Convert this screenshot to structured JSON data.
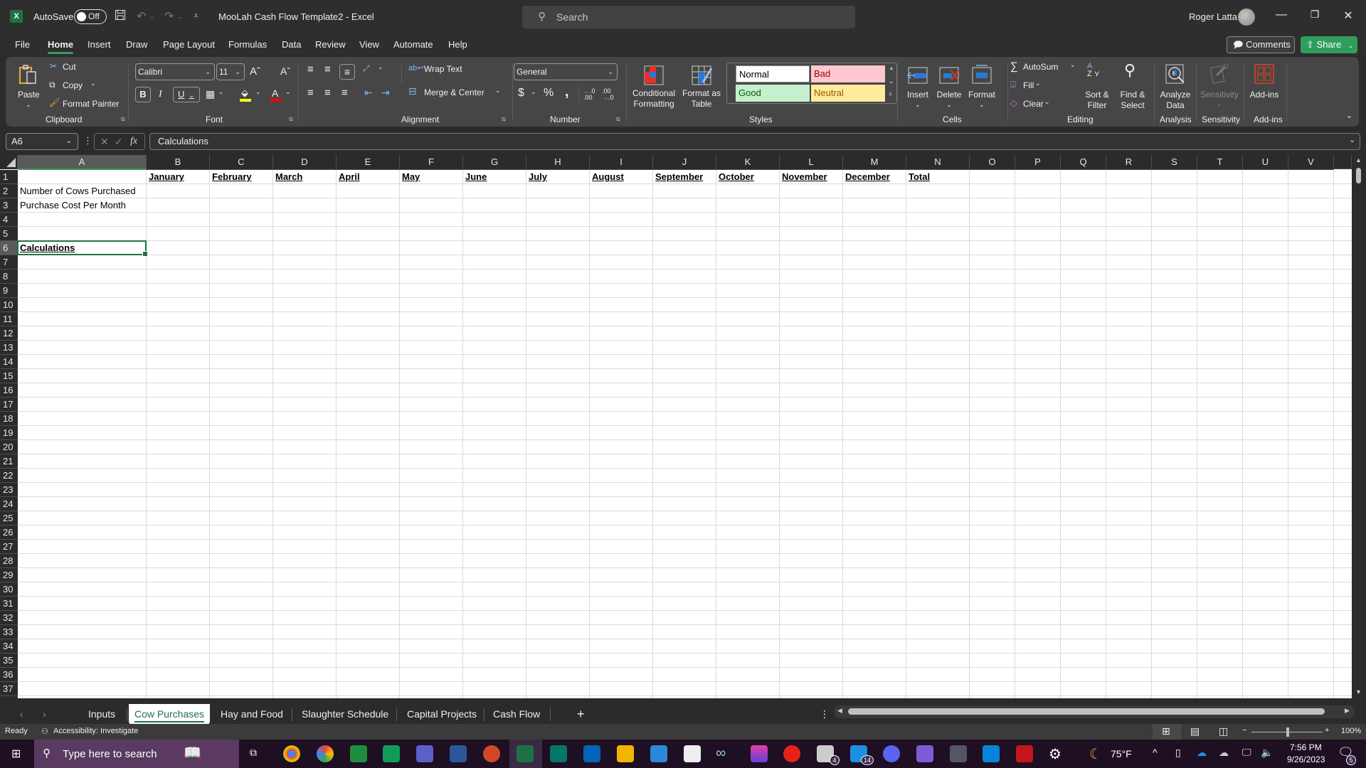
{
  "titlebar": {
    "app_logo": "X",
    "autosave_label": "AutoSave",
    "autosave_state": "Off",
    "document_title": "MooLah Cash Flow Template2  -  Excel",
    "search_placeholder": "Search",
    "user_name": "Roger Latta",
    "icons": {
      "save": "save-icon",
      "undo": "undo-icon",
      "redo": "redo-icon",
      "customize": "customize-qat-icon"
    }
  },
  "menu": {
    "tabs": [
      "File",
      "Home",
      "Insert",
      "Draw",
      "Page Layout",
      "Formulas",
      "Data",
      "Review",
      "View",
      "Automate",
      "Help"
    ],
    "active": "Home",
    "comments_label": "Comments",
    "share_label": "Share"
  },
  "ribbon": {
    "clipboard": {
      "label": "Clipboard",
      "paste": "Paste",
      "cut": "Cut",
      "copy": "Copy",
      "format_painter": "Format Painter"
    },
    "font": {
      "label": "Font",
      "font_name": "Calibri",
      "font_size": "11",
      "bold": "B",
      "italic": "I",
      "underline": "U",
      "fill_color": "#ffff00",
      "font_color": "#ff0000"
    },
    "alignment": {
      "label": "Alignment",
      "wrap_text": "Wrap Text",
      "merge_center": "Merge & Center"
    },
    "number": {
      "label": "Number",
      "format": "General",
      "currency": "$",
      "percent": "%",
      "comma": ","
    },
    "styles": {
      "label": "Styles",
      "conditional_formatting": [
        "Conditional",
        "Formatting"
      ],
      "format_as_table": [
        "Format as",
        "Table"
      ],
      "cells": [
        {
          "name": "Normal",
          "bg": "#ffffff",
          "fg": "#000000"
        },
        {
          "name": "Bad",
          "bg": "#ffc7ce",
          "fg": "#9c0006"
        },
        {
          "name": "Good",
          "bg": "#c6efce",
          "fg": "#006100"
        },
        {
          "name": "Neutral",
          "bg": "#ffeb9c",
          "fg": "#9c5700"
        }
      ]
    },
    "cells": {
      "label": "Cells",
      "insert": "Insert",
      "delete": "Delete",
      "format": "Format"
    },
    "editing": {
      "label": "Editing",
      "autosum": "AutoSum",
      "fill": "Fill",
      "clear": "Clear",
      "sort_filter": [
        "Sort &",
        "Filter"
      ],
      "find_select": [
        "Find &",
        "Select"
      ]
    },
    "analysis": {
      "label": "Analysis",
      "analyze_data": [
        "Analyze",
        "Data"
      ]
    },
    "sensitivity": {
      "label": "Sensitivity",
      "button": "Sensitivity"
    },
    "addins": {
      "label": "Add-ins",
      "button": "Add-ins"
    }
  },
  "formula_bar": {
    "name_box": "A6",
    "formula": "Calculations"
  },
  "sheet": {
    "columns": [
      "A",
      "B",
      "C",
      "D",
      "E",
      "F",
      "G",
      "H",
      "I",
      "J",
      "K",
      "L",
      "M",
      "N",
      "O",
      "P",
      "Q",
      "R",
      "S",
      "T",
      "U",
      "V"
    ],
    "selected_cell": "A6",
    "visible_rows": 37,
    "cells": {
      "B1": "January",
      "C1": "February",
      "D1": "March",
      "E1": "April",
      "F1": "May",
      "G1": "June",
      "H1": "July",
      "I1": "August",
      "J1": "September",
      "K1": "October",
      "L1": "November",
      "M1": "December",
      "N1": "Total",
      "A2": "Number of Cows Purchased",
      "A3": "Purchase Cost Per Month",
      "A6": "Calculations"
    },
    "bold_underlined_cells": [
      "B1",
      "C1",
      "D1",
      "E1",
      "F1",
      "G1",
      "H1",
      "I1",
      "J1",
      "K1",
      "L1",
      "M1",
      "N1",
      "A6"
    ]
  },
  "sheet_tabs": {
    "tabs": [
      "Inputs",
      "Cow Purchases",
      "Hay and Food",
      "Slaughter Schedule",
      "Capital Projects",
      "Cash Flow"
    ],
    "active": "Cow Purchases",
    "add_label": "+"
  },
  "statusbar": {
    "status": "Ready",
    "accessibility": "Accessibility: Investigate",
    "zoom": "100%"
  },
  "taskbar": {
    "search_placeholder": "Type here to search",
    "weather": "75°F",
    "time": "7:56 PM",
    "date": "9/26/2023",
    "badges": {
      "mail_app": "4",
      "app_14": "14",
      "notifications": "5"
    }
  }
}
